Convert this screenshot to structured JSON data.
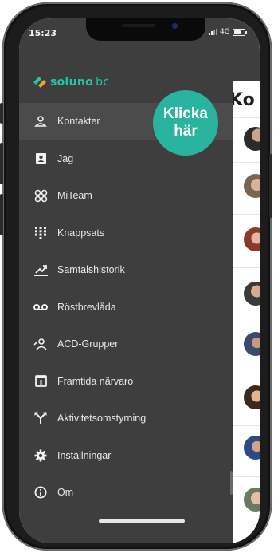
{
  "status_bar": {
    "time": "15:23",
    "network": "4G"
  },
  "brand": {
    "logo_part1": "soluno",
    "logo_part2": "bc",
    "accent": "#24c4a8"
  },
  "menu": {
    "items": [
      {
        "label": "Kontakter",
        "icon": "contacts-icon",
        "active": true
      },
      {
        "label": "Jag",
        "icon": "id-card-icon"
      },
      {
        "label": "MiTeam",
        "icon": "team-icon"
      },
      {
        "label": "Knappsats",
        "icon": "keypad-icon"
      },
      {
        "label": "Samtalshistorik",
        "icon": "call-history-icon"
      },
      {
        "label": "Röstbrevlåda",
        "icon": "voicemail-icon"
      },
      {
        "label": "ACD-Grupper",
        "icon": "acd-groups-icon"
      },
      {
        "label": "Framtida närvaro",
        "icon": "calendar-icon"
      },
      {
        "label": "Aktivitetsomstyrning",
        "icon": "redirect-icon"
      },
      {
        "label": "Inställningar",
        "icon": "settings-gear-icon"
      },
      {
        "label": "Om",
        "icon": "info-icon"
      }
    ]
  },
  "callout": {
    "line1": "Klicka",
    "line2": "här",
    "color": "#2ab39f"
  },
  "background_page": {
    "title_fragment": "Ko"
  }
}
